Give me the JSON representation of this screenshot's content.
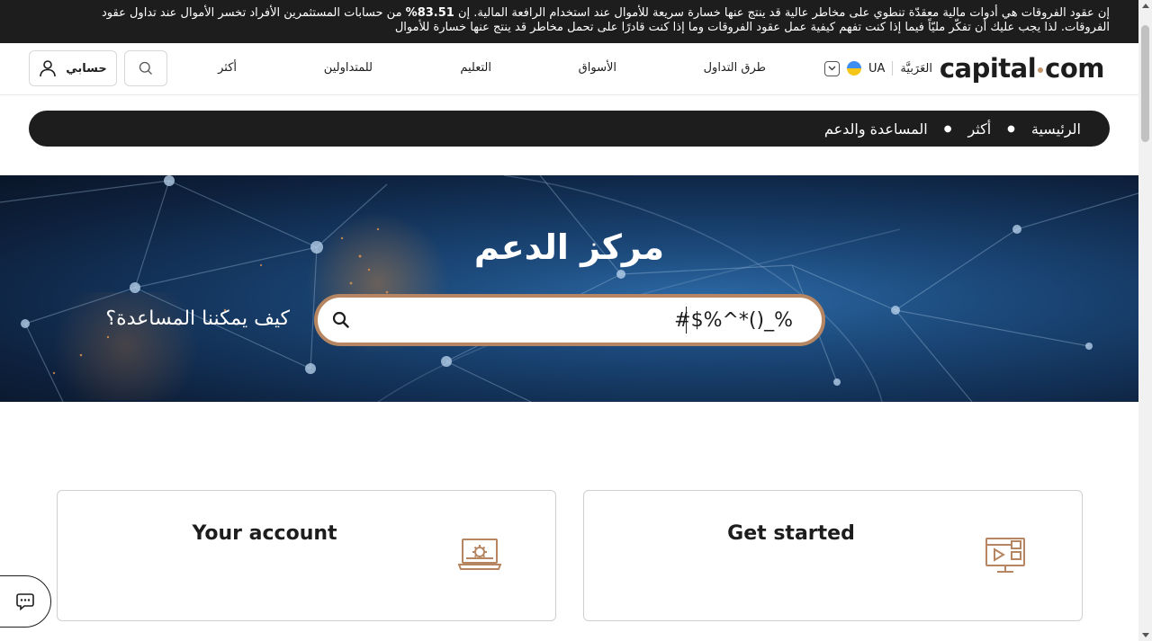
{
  "risk_banner": {
    "line1_pre": "إن عقود الفروقات هي أدوات مالية معقدّة تنطوي على مخاطر عالية قد ينتج عنها خسارة سريعة للأموال عند استخدام الرافعة المالية. إن ",
    "line1_percent": "83.51%",
    "line1_post": " من حسابات المستثمرين الأفراد تخسر الأموال عند تداول عقود",
    "line2": "الفروقات. لذا يجب عليك أن تفكّر مليّاً فيما إذا كنت تفهم كيفية عمل عقود الفروقات وما إذا كنت قادرًا على تحمل مخاطر قد ينتج عنها خسارة للأموال"
  },
  "header": {
    "logo_left": "capital",
    "logo_right": "com",
    "language_label": "العَرَبيَّة",
    "region_label": "UA",
    "nav": {
      "ways_to_trade": "طرق التداول",
      "markets": "الأسواق",
      "education": "التعليم",
      "traders": "للمتداولين",
      "more": "أكثر"
    },
    "account_label": "حسابي"
  },
  "breadcrumb": {
    "home": "الرئيسية",
    "more": "أكثر",
    "current": "المساعدة والدعم"
  },
  "hero": {
    "title": "مركز الدعم",
    "question": "كيف يمكننا المساعدة؟",
    "search_value": "#$%^*()_%"
  },
  "cards": {
    "get_started": "Get started",
    "your_account": "Your account"
  },
  "colors": {
    "accent": "#b68662",
    "dark": "#1d1d1d"
  },
  "icons": [
    "chevron-down-icon",
    "search-icon",
    "user-icon",
    "play-screen-icon",
    "gear-laptop-icon",
    "chat-icon"
  ]
}
